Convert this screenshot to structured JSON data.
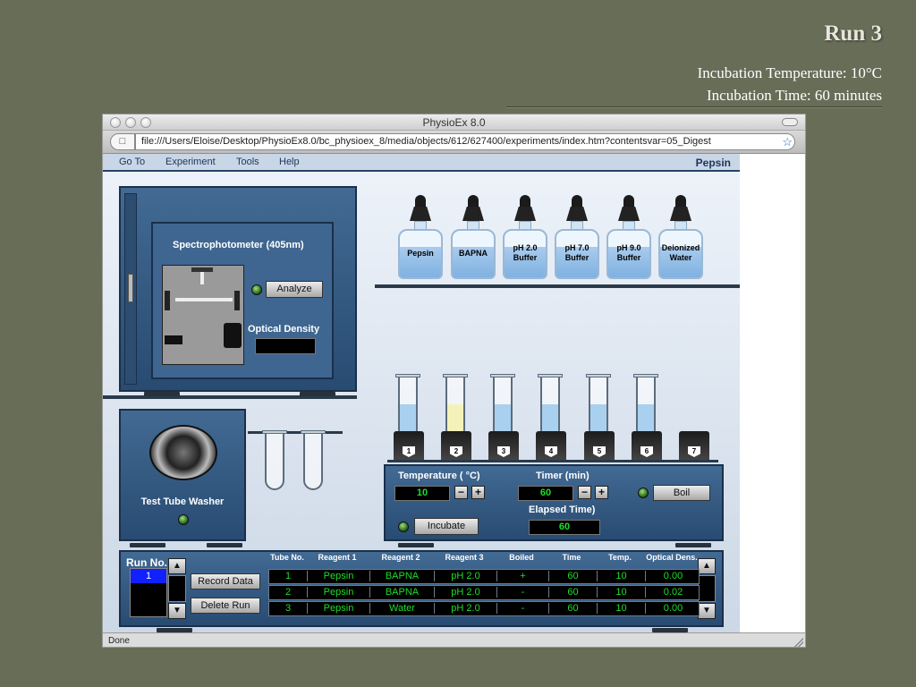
{
  "slide": {
    "title": "Run 3",
    "line1": "Incubation Temperature: 10°C",
    "line2": "Incubation Time: 60 minutes"
  },
  "browser": {
    "title": "PhysioEx 8.0",
    "url": "file:///Users/Eloise/Desktop/PhysioEx8.0/bc_physioex_8/media/objects/612/627400/experiments/index.htm?contentsvar=05_Digest",
    "status": "Done"
  },
  "menu": {
    "items": [
      "Go To",
      "Experiment",
      "Tools",
      "Help"
    ],
    "experiment": "Pepsin"
  },
  "spectro": {
    "title": "Spectrophotometer (405nm)",
    "analyze_label": "Analyze",
    "od_label": "Optical Density",
    "od_value": ""
  },
  "bottles": [
    "Pepsin",
    "BAPNA",
    "pH 2.0\nBuffer",
    "pH 7.0\nBuffer",
    "pH 9.0\nBuffer",
    "Deionized\nWater"
  ],
  "tubes": [
    {
      "num": "1",
      "fill": 0.55,
      "color": "#a9d0ef"
    },
    {
      "num": "2",
      "fill": 0.55,
      "color": "#f4f2b8"
    },
    {
      "num": "3",
      "fill": 0.55,
      "color": "#a9d0ef"
    },
    {
      "num": "4",
      "fill": 0.55,
      "color": "#a9d0ef"
    },
    {
      "num": "5",
      "fill": 0.55,
      "color": "#a9d0ef"
    },
    {
      "num": "6",
      "fill": 0.55,
      "color": "#a9d0ef"
    },
    {
      "num": "7",
      "fill": 0,
      "color": "#a9d0ef"
    }
  ],
  "washer": {
    "label": "Test Tube Washer"
  },
  "controls": {
    "temp_label": "Temperature ( °C)",
    "temp_value": "10",
    "timer_label": "Timer (min)",
    "timer_value": "60",
    "boil_label": "Boil",
    "elapsed_label": "Elapsed Time)",
    "elapsed_value": "60",
    "incubate_label": "Incubate"
  },
  "run": {
    "label": "Run No.",
    "value": "1",
    "record_label": "Record Data",
    "delete_label": "Delete Run"
  },
  "table": {
    "headers": [
      "Tube No.",
      "Reagent 1",
      "Reagent 2",
      "Reagent 3",
      "Boiled",
      "Time",
      "Temp.",
      "Optical Dens."
    ],
    "rows": [
      [
        "1",
        "Pepsin",
        "BAPNA",
        "pH 2.0",
        "+",
        "60",
        "10",
        "0.00"
      ],
      [
        "2",
        "Pepsin",
        "BAPNA",
        "pH 2.0",
        "-",
        "60",
        "10",
        "0.02"
      ],
      [
        "3",
        "Pepsin",
        "Water",
        "pH 2.0",
        "-",
        "60",
        "10",
        "0.00"
      ]
    ]
  },
  "colors": {
    "lcd_green": "#1fdc2a",
    "panel_blue": "#2f5680"
  }
}
